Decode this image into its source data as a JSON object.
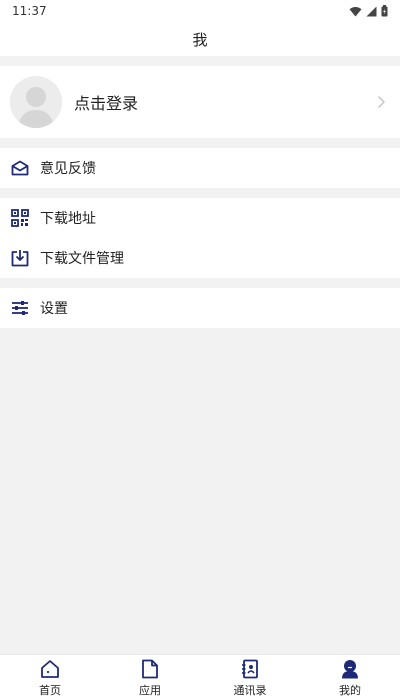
{
  "status": {
    "time": "11:37",
    "icons": [
      "wifi-icon",
      "signal-icon",
      "battery-icon"
    ]
  },
  "header": {
    "title": "我"
  },
  "profile": {
    "login_text": "点击登录"
  },
  "menu": {
    "feedback": {
      "label": "意见反馈",
      "icon": "mail-icon"
    },
    "download_address": {
      "label": "下载地址",
      "icon": "qrcode-icon"
    },
    "download_manager": {
      "label": "下载文件管理",
      "icon": "download-icon"
    },
    "settings": {
      "label": "设置",
      "icon": "sliders-icon"
    }
  },
  "tabs": [
    {
      "label": "首页",
      "icon": "home-icon"
    },
    {
      "label": "应用",
      "icon": "file-icon"
    },
    {
      "label": "通讯录",
      "icon": "contacts-icon"
    },
    {
      "label": "我的",
      "icon": "user-icon",
      "active": true
    }
  ],
  "colors": {
    "accent": "#1e2a78",
    "background": "#f2f2f2",
    "surface": "#ffffff"
  }
}
